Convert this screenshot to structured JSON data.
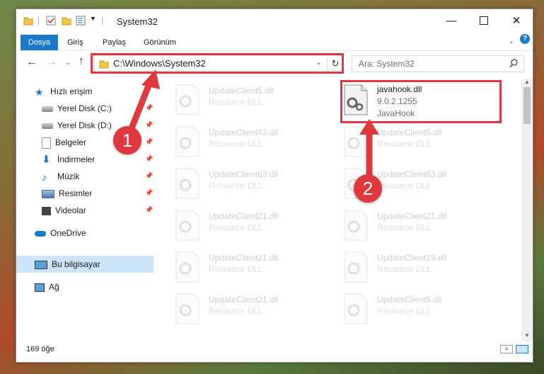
{
  "window": {
    "title": "System32"
  },
  "ribbon": {
    "tabs": [
      "Dosya",
      "Giriş",
      "Paylaş",
      "Görünüm"
    ]
  },
  "address": {
    "path": "C:\\Windows\\System32"
  },
  "search": {
    "placeholder": "Ara: System32"
  },
  "nav": {
    "quick_access": "Hızlı erişim",
    "items": [
      "Yerel Disk (C:)",
      "Yerel Disk (D:)",
      "Belgeler",
      "İndirmeler",
      "Müzik",
      "Resimler",
      "Videolar"
    ],
    "onedrive": "OneDrive",
    "this_pc": "Bu bilgisayar",
    "network": "Ağ"
  },
  "files": {
    "left": [
      {
        "name": "UpdateClient5.dll",
        "type": "Resource DLL"
      },
      {
        "name": "UpdateClient42.dll",
        "type": "Resource DLL"
      },
      {
        "name": "UpdateClient63.dll",
        "type": "Resource DLL"
      },
      {
        "name": "UpdateClient21.dll",
        "type": "Resource DLL"
      },
      {
        "name": "UpdateClient21.dll",
        "type": "Resource DLL"
      },
      {
        "name": "UpdateClient21.dll",
        "type": "Resource DLL"
      }
    ],
    "highlight": {
      "name": "javahook.dll",
      "version": "9.0.2.1255",
      "desc": "JavaHook"
    },
    "right": [
      {
        "name": "UpdateClient5.dll",
        "type": "Resource DLL"
      },
      {
        "name": "UpdateClient63.dll",
        "type": "Resource DLL"
      },
      {
        "name": "UpdateClient21.dll",
        "type": "Resource DLL"
      },
      {
        "name": "UpdateClient19.dll",
        "type": "Resource DLL"
      },
      {
        "name": "UpdateClient5.dll",
        "type": "Resource DLL"
      }
    ]
  },
  "status": {
    "count": "169 öğe"
  },
  "annotations": {
    "badge1": "1",
    "badge2": "2"
  },
  "colors": {
    "accent": "#1979ca",
    "annotation": "#e0383e"
  }
}
